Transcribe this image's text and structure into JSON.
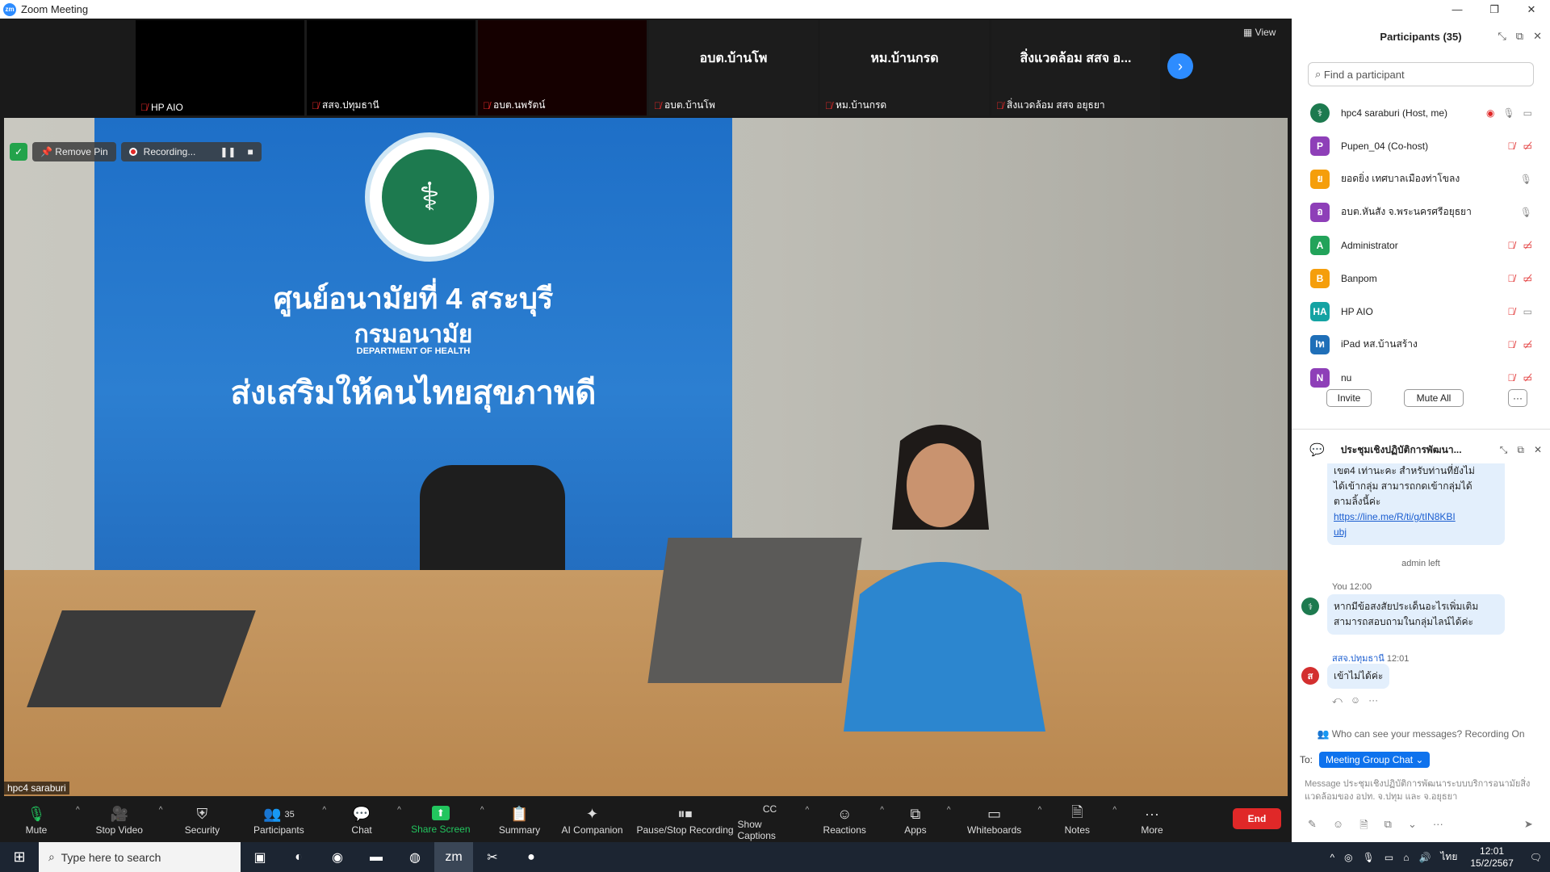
{
  "window": {
    "title": "Zoom Meeting",
    "min": "—",
    "max": "❐",
    "close": "✕"
  },
  "gallery": {
    "view_label": "View",
    "tiles": [
      {
        "name": "HP AIO",
        "center": ""
      },
      {
        "name": "สสจ.ปทุมธานี",
        "center": ""
      },
      {
        "name": "อบต.นพรัตน์",
        "center": ""
      },
      {
        "name": "อบต.บ้านโพ",
        "center": "อบต.บ้านโพ"
      },
      {
        "name": "หม.บ้านกรด",
        "center": "หม.บ้านกรด"
      },
      {
        "name": "สิ่งแวดล้อม สสจ อยุธยา",
        "center": "สิ่งแวดล้อม สสจ อ..."
      }
    ]
  },
  "stage": {
    "remove_pin": "Remove Pin",
    "recording": "Recording...",
    "self_label": "hpc4 saraburi",
    "banner": {
      "line1": "ศูนย์อนามัยที่ 4 สระบุรี",
      "line2": "กรมอนามัย",
      "line3": "DEPARTMENT OF HEALTH",
      "line4": "ส่งเสริมให้คนไทยสุขภาพดี"
    }
  },
  "toolbar": {
    "mute": "Mute",
    "stop_video": "Stop Video",
    "security": "Security",
    "participants": "Participants",
    "participants_count": "35",
    "chat": "Chat",
    "share_screen": "Share Screen",
    "summary": "Summary",
    "ai_companion": "AI Companion",
    "pause_stop_recording": "Pause/Stop Recording",
    "show_captions": "Show Captions",
    "reactions": "Reactions",
    "apps": "Apps",
    "whiteboards": "Whiteboards",
    "notes": "Notes",
    "more": "More",
    "end": "End"
  },
  "participants_panel": {
    "title": "Participants (35)",
    "search_placeholder": "Find a participant",
    "people": [
      {
        "initial": "",
        "name": "hpc4 saraburi (Host, me)",
        "color": "#1d7a4f"
      },
      {
        "initial": "P",
        "name": "Pupen_04 (Co-host)",
        "color": "#8e3fb8"
      },
      {
        "initial": "ย",
        "name": "ยอดยิ่ง เทศบาลเมืองท่าโขลง",
        "color": "#f59e0b"
      },
      {
        "initial": "อ",
        "name": "อบต.หันสัง จ.พระนครศรีอยุธยา",
        "color": "#8e3fb8"
      },
      {
        "initial": "A",
        "name": "Administrator",
        "color": "#22a35a"
      },
      {
        "initial": "B",
        "name": "Banpom",
        "color": "#f59e0b"
      },
      {
        "initial": "HA",
        "name": "HP AIO",
        "color": "#14a3a3"
      },
      {
        "initial": "Iท",
        "name": "iPad หส.บ้านสร้าง",
        "color": "#1f6fb8"
      },
      {
        "initial": "N",
        "name": "nu",
        "color": "#8e3fb8"
      }
    ],
    "invite": "Invite",
    "mute_all": "Mute All",
    "more": "···"
  },
  "chat_panel": {
    "title": "ประชุมเชิงปฏิบัติการพัฒนา...",
    "msg1_line1": "เขต4  เท่านะคะ สำหรับท่านที่ยังไม่",
    "msg1_line2": "ได้เข้ากลุ่ม สามารถกดเข้ากลุ่มได้",
    "msg1_line3": "ตามลิ้งนี้ค่ะ",
    "msg1_link1": "https://line.me/R/ti/g/tIN8KBI",
    "msg1_link2": "ubj",
    "sys_note": "admin left",
    "you_sender": "You 12:00",
    "msg2_line1": "หากมีข้อสงสัยประเด็นอะไรเพิ่มเติม",
    "msg2_line2": "สามารถสอบถามในกลุ่มไลน์ได้ค่ะ",
    "sender3_name": "สสจ.ปทุมธานี",
    "sender3_time": "12:01",
    "sender3_initial": "ส",
    "msg3": "เข้าไม่ได้ค่ะ",
    "who_can_see": "Who can see your messages? Recording On",
    "to_label": "To:",
    "to_value": "Meeting Group Chat ⌄",
    "input_line1": "Message ประชุมเชิงปฏิบัติการพัฒนาระบบบริการอนามัยสิ่ง",
    "input_line2": "แวดล้อมของ อปท. จ.ปทุม และ จ.อยุธยา"
  },
  "taskbar": {
    "search_placeholder": "Type here to search",
    "lang": "ไทย",
    "time": "12:01",
    "date": "15/2/2567"
  }
}
